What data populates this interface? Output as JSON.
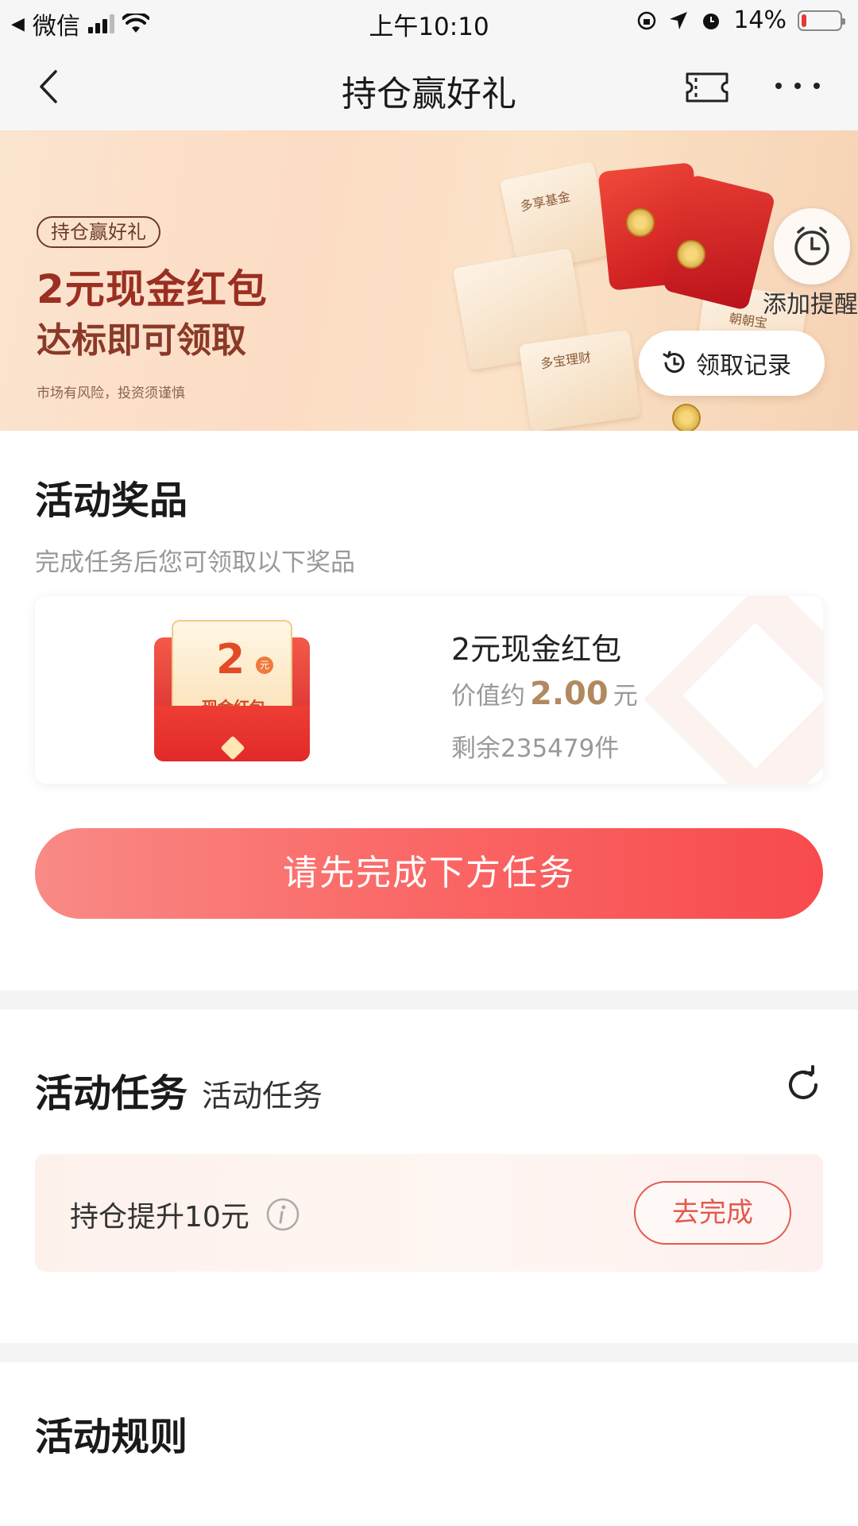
{
  "status_bar": {
    "carrier": "微信",
    "time": "上午10:10",
    "battery": "14%",
    "battery_level": 0.14
  },
  "nav": {
    "title": "持仓赢好礼"
  },
  "banner": {
    "tag": "持仓赢好礼",
    "headline": "2元现金红包",
    "subline": "达标即可领取",
    "risk_notice": "市场有风险，投资须谨慎",
    "box_labels": [
      "多享基金",
      "朝朝宝",
      "多宝理财"
    ],
    "remind_label": "添加提醒",
    "record_label": "领取记录"
  },
  "prizes": {
    "title": "活动奖品",
    "subtitle": "完成任务后您可领取以下奖品",
    "item": {
      "badge_amount": "2",
      "badge_unit": "元",
      "badge_text": "现金红包",
      "name": "2元现金红包",
      "value_prefix": "价值约",
      "value_number": "2.00",
      "value_unit": "元",
      "stock": "剩余235479件"
    },
    "cta_label": "请先完成下方任务"
  },
  "tasks": {
    "title": "活动任务",
    "subtitle": "活动任务",
    "items": [
      {
        "name": "持仓提升10元",
        "action": "去完成"
      }
    ]
  },
  "rules": {
    "title": "活动规则"
  },
  "colors": {
    "accent_red": "#f84a4d",
    "gold": "#b08a5e",
    "task_border": "#e35a4e"
  }
}
